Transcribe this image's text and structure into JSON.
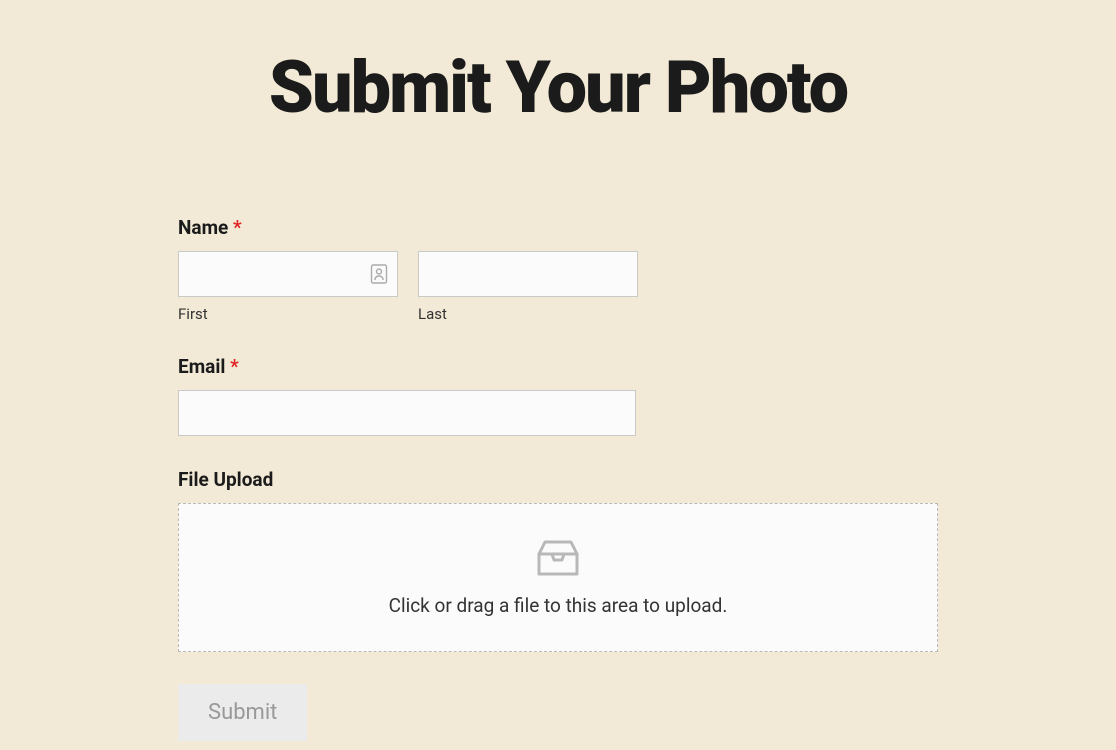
{
  "title": "Submit Your Photo",
  "form": {
    "name": {
      "label": "Name",
      "required": "*",
      "first": {
        "value": "",
        "sublabel": "First"
      },
      "last": {
        "value": "",
        "sublabel": "Last"
      }
    },
    "email": {
      "label": "Email",
      "required": "*",
      "value": ""
    },
    "file_upload": {
      "label": "File Upload",
      "hint": "Click or drag a file to this area to upload."
    },
    "submit_label": "Submit"
  }
}
